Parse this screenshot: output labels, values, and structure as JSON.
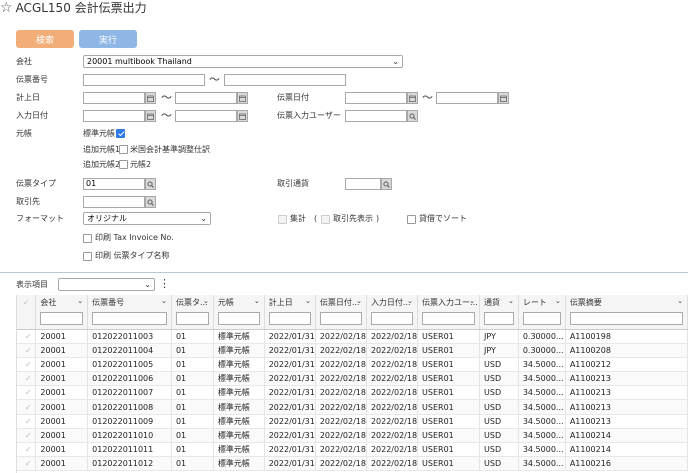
{
  "header": {
    "title": "ACGL150 会計伝票出力",
    "star_icon": "star-outline-icon"
  },
  "toolbar": {
    "search_label": "検索",
    "exec_label": "実行",
    "search_color": "#f2ae79",
    "exec_color": "#8fb7e6"
  },
  "form": {
    "company_label": "会社",
    "company_value": "20001 multibook Thailand",
    "voucher_no_label": "伝票番号",
    "posting_date_label": "計上日",
    "voucher_date_label": "伝票日付",
    "input_date_label": "入力日付",
    "input_user_label": "伝票入力ユーザー",
    "ledger_label": "元帳",
    "std_ledger_label": "標準元帳",
    "add_ledger1_label": "追加元帳1",
    "add_ledger1_option": "米国会計基準調整仕訳",
    "add_ledger2_label": "追加元帳2",
    "add_ledger2_option": "元帳2",
    "voucher_type_label": "伝票タイプ",
    "voucher_type_value": "01",
    "trade_currency_label": "取引通貨",
    "partner_label": "取引先",
    "format_label": "フォーマット",
    "format_value": "オリジナル",
    "aggregate_label": "集計",
    "paren_open": "(",
    "show_partner_label": "取引先表示",
    "paren_close": ")",
    "sort_label": "貸借でソート",
    "print_tax_label": "印刷 Tax Invoice No.",
    "print_type_label": "印刷 伝票タイプ名称",
    "tilde": "〜"
  },
  "grid": {
    "display_items_label": "表示項目",
    "columns": [
      "会社",
      "伝票番号",
      "伝票タ...",
      "元帳",
      "計上日",
      "伝票日付...",
      "入力日付...",
      "伝票入力ユー...",
      "通貨",
      "レート",
      "伝票摘要"
    ],
    "rows": [
      [
        "20001",
        "012022011003",
        "01",
        "標準元帳",
        "2022/01/31",
        "2022/02/18",
        "2022/02/18",
        "USER01",
        "JPY",
        "0.30000...",
        "A1100198"
      ],
      [
        "20001",
        "012022011004",
        "01",
        "標準元帳",
        "2022/01/31",
        "2022/02/18",
        "2022/02/18",
        "USER01",
        "JPY",
        "0.30000...",
        "A1100208"
      ],
      [
        "20001",
        "012022011005",
        "01",
        "標準元帳",
        "2022/01/31",
        "2022/02/18",
        "2022/02/18",
        "USER01",
        "USD",
        "34.5000...",
        "A1100212"
      ],
      [
        "20001",
        "012022011006",
        "01",
        "標準元帳",
        "2022/01/31",
        "2022/02/18",
        "2022/02/18",
        "USER01",
        "USD",
        "34.5000...",
        "A1100213"
      ],
      [
        "20001",
        "012022011007",
        "01",
        "標準元帳",
        "2022/01/31",
        "2022/02/18",
        "2022/02/18",
        "USER01",
        "USD",
        "34.5000...",
        "A1100213"
      ],
      [
        "20001",
        "012022011008",
        "01",
        "標準元帳",
        "2022/01/31",
        "2022/02/18",
        "2022/02/18",
        "USER01",
        "USD",
        "34.5000...",
        "A1100213"
      ],
      [
        "20001",
        "012022011009",
        "01",
        "標準元帳",
        "2022/01/31",
        "2022/02/18",
        "2022/02/18",
        "USER01",
        "USD",
        "34.5000...",
        "A1100213"
      ],
      [
        "20001",
        "012022011010",
        "01",
        "標準元帳",
        "2022/01/31",
        "2022/02/18",
        "2022/02/18",
        "USER01",
        "USD",
        "34.5000...",
        "A1100214"
      ],
      [
        "20001",
        "012022011011",
        "01",
        "標準元帳",
        "2022/01/31",
        "2022/02/18",
        "2022/02/18",
        "USER01",
        "USD",
        "34.5000...",
        "A1100214"
      ],
      [
        "20001",
        "012022011012",
        "01",
        "標準元帳",
        "2022/01/31",
        "2022/02/18",
        "2022/02/18",
        "USER01",
        "USD",
        "34.5000...",
        "A1100216"
      ]
    ]
  }
}
